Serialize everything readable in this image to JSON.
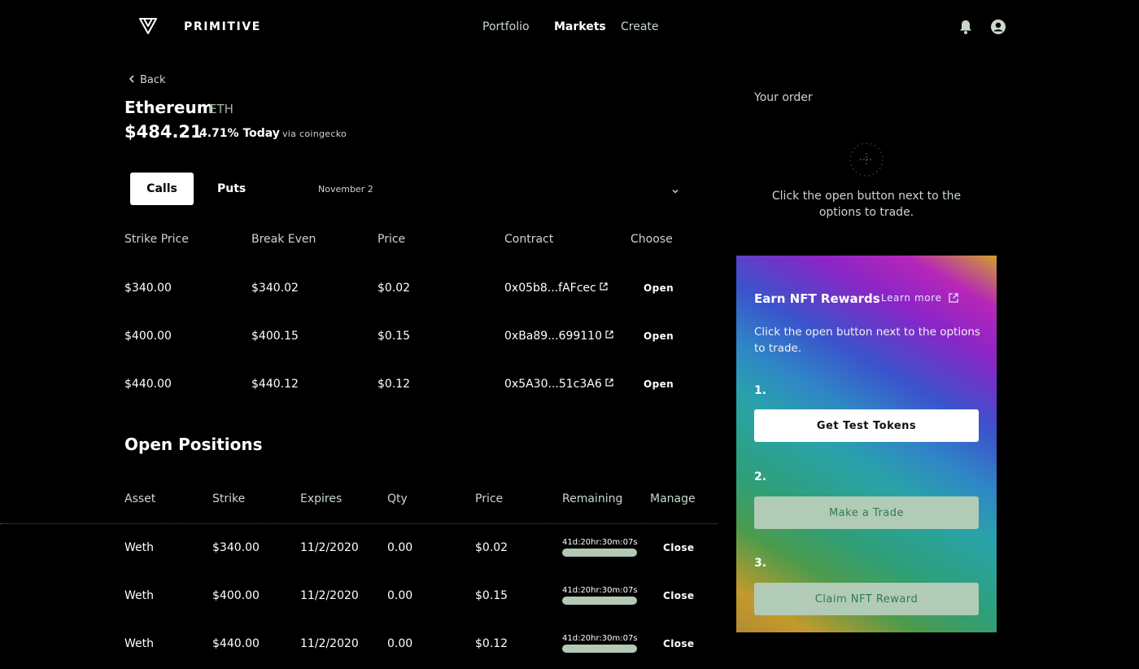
{
  "header": {
    "brand": "PRIMITIVE",
    "nav": {
      "portfolio": "Portfolio",
      "markets": "Markets",
      "create": "Create"
    },
    "active": "Markets"
  },
  "asset": {
    "back_label": "Back",
    "name": "Ethereum",
    "symbol": "ETH",
    "price": "$484.21",
    "change": "4.71% Today",
    "source": "via coingecko"
  },
  "options": {
    "tabs": {
      "calls": "Calls",
      "puts": "Puts"
    },
    "expiry": "November 2",
    "headers": {
      "strike": "Strike Price",
      "break_even": "Break Even",
      "price": "Price",
      "contract": "Contract",
      "choose": "Choose"
    },
    "rows": [
      {
        "strike": "$340.00",
        "break_even": "$340.02",
        "price": "$0.02",
        "contract": "0x05b8...fAFcec",
        "action": "Open"
      },
      {
        "strike": "$400.00",
        "break_even": "$400.15",
        "price": "$0.15",
        "contract": "0xBa89...699110",
        "action": "Open"
      },
      {
        "strike": "$440.00",
        "break_even": "$440.12",
        "price": "$0.12",
        "contract": "0x5A30...51c3A6",
        "action": "Open"
      }
    ]
  },
  "positions": {
    "title": "Open Positions",
    "headers": {
      "asset": "Asset",
      "strike": "Strike",
      "expires": "Expires",
      "qty": "Qty",
      "price": "Price",
      "remaining": "Remaining",
      "manage": "Manage"
    },
    "rows": [
      {
        "asset": "Weth",
        "strike": "$340.00",
        "expires": "11/2/2020",
        "qty": "0.00",
        "price": "$0.02",
        "remaining": "41d:20hr:30m:07s",
        "action": "Close"
      },
      {
        "asset": "Weth",
        "strike": "$400.00",
        "expires": "11/2/2020",
        "qty": "0.00",
        "price": "$0.15",
        "remaining": "41d:20hr:30m:07s",
        "action": "Close"
      },
      {
        "asset": "Weth",
        "strike": "$440.00",
        "expires": "11/2/2020",
        "qty": "0.00",
        "price": "$0.12",
        "remaining": "41d:20hr:30m:07s",
        "action": "Close"
      }
    ]
  },
  "order": {
    "title": "Your order",
    "hint": "Click the open button next to the options to trade."
  },
  "nft": {
    "title": "Earn NFT Rewards",
    "learn_more": "Learn more",
    "description": "Click the open button next to the options to trade.",
    "steps": [
      {
        "number": "1.",
        "label": "Get Test Tokens"
      },
      {
        "number": "2.",
        "label": "Make a Trade"
      },
      {
        "number": "3.",
        "label": "Claim NFT Reward"
      }
    ]
  },
  "colors": {
    "background": "#000000",
    "muted_text": "#c9d8c9",
    "disabled_button": "#b2cbb6",
    "progress_bar": "#b4c8b6"
  }
}
